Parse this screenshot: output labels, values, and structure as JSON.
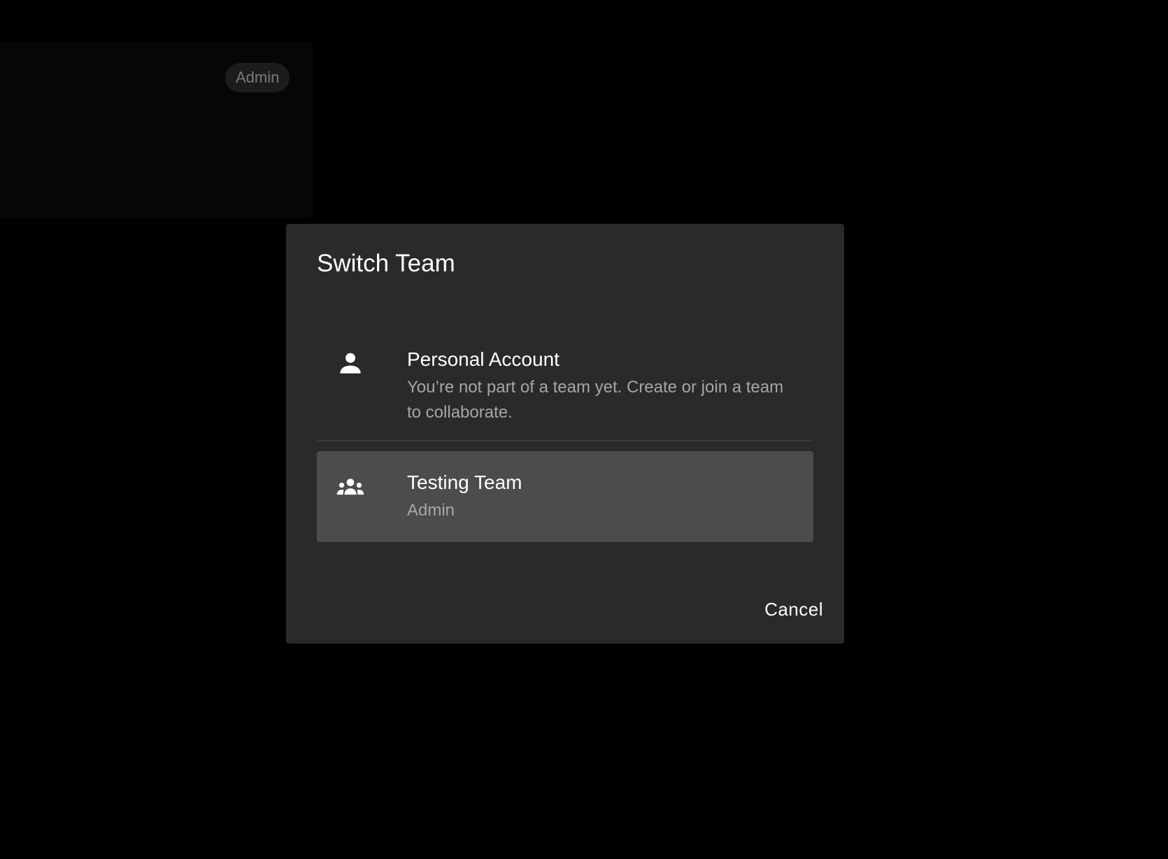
{
  "background": {
    "badge_label": "Admin"
  },
  "dialog": {
    "title": "Switch Team",
    "options": [
      {
        "icon": "person-icon",
        "title": "Personal Account",
        "subtitle": "You’re not part of a team yet. Create or join a team to collaborate.",
        "selected": false
      },
      {
        "icon": "group-icon",
        "title": "Testing Team",
        "subtitle": "Admin",
        "selected": true
      }
    ],
    "cancel_label": "Cancel"
  },
  "colors": {
    "page_background": "#000000",
    "dialog_background": "#2a2a2a",
    "selected_option_background": "#4c4c4c",
    "primary_text": "#ffffff",
    "secondary_text": "#a6a6a6"
  }
}
